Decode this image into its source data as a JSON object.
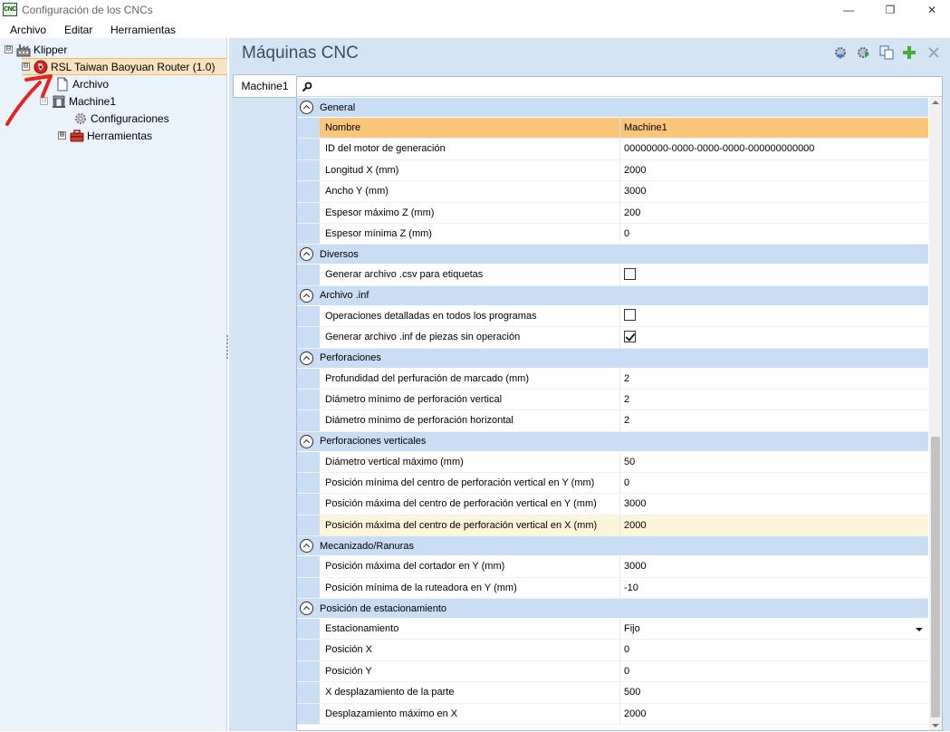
{
  "window": {
    "title": "Configuración de los CNCs",
    "icon_text": "CNC",
    "minimize": "—",
    "maximize": "❐",
    "close": "✕"
  },
  "menu": [
    "Archivo",
    "Editar",
    "Herramientas"
  ],
  "tree": [
    {
      "label": "Klipper",
      "expander": "⊟",
      "icon": "factory-icon"
    },
    {
      "label": "RSL Taiwan Baoyuan Router (1.0)",
      "expander": "⊟",
      "icon": "router-icon",
      "selected": true
    },
    {
      "label": "Archivo",
      "icon": "file-icon"
    },
    {
      "label": "Machine1",
      "expander": "⊟",
      "icon": "machine-icon"
    },
    {
      "label": "Configuraciones",
      "icon": "gear-icon"
    },
    {
      "label": "Herramientas",
      "expander": "⊞",
      "icon": "toolbox-icon"
    }
  ],
  "main": {
    "title": "Máquinas CNC",
    "toolbar_icons": [
      "gear-import-icon",
      "gear-export-icon",
      "copy-icon",
      "add-icon",
      "delete-icon"
    ],
    "tabs": [
      "Machine1"
    ],
    "search": {
      "value": "",
      "placeholder": ""
    }
  },
  "colors": {
    "selection": "#f9c67a",
    "tree_selection": "#fbe3c1",
    "category_bg": "#c9ddf5",
    "panel_bg": "#d5e4f5",
    "annotation": "#e8231e"
  },
  "grid": [
    {
      "category": "General",
      "rows": [
        {
          "name": "Nombre",
          "value": "Machine1",
          "selected": true
        },
        {
          "name": "ID del motor de generación",
          "value": "00000000-0000-0000-0000-000000000000"
        },
        {
          "name": "Longitud X (mm)",
          "value": "2000"
        },
        {
          "name": "Ancho Y (mm)",
          "value": "3000"
        },
        {
          "name": "Espesor máximo Z (mm)",
          "value": "200"
        },
        {
          "name": "Espesor mínima Z (mm)",
          "value": "0"
        }
      ]
    },
    {
      "category": "Diversos",
      "rows": [
        {
          "name": "Generar archivo .csv para etiquetas",
          "checkbox": false
        }
      ]
    },
    {
      "category": "Archivo .inf",
      "rows": [
        {
          "name": "Operaciones detalladas en todos los programas",
          "checkbox": false
        },
        {
          "name": "Generar archivo .inf de piezas sin operación",
          "checkbox": true
        }
      ]
    },
    {
      "category": "Perforaciones",
      "rows": [
        {
          "name": "Profundidad del perfuración de marcado (mm)",
          "value": "2"
        },
        {
          "name": "Diámetro mínimo de perforación vertical",
          "value": "2"
        },
        {
          "name": "Diámetro mínimo de perforación horizontal",
          "value": "2"
        }
      ]
    },
    {
      "category": "Perforaciones verticales",
      "rows": [
        {
          "name": "Diámetro vertical máximo (mm)",
          "value": "50"
        },
        {
          "name": "Posición mínima del centro de perforación vertical en Y (mm)",
          "value": "0"
        },
        {
          "name": "Posición máxima del centro de perforación vertical en Y (mm)",
          "value": "3000"
        },
        {
          "name": "Posición máxima del centro de perforación vertical en X (mm)",
          "value": "2000",
          "highlight": true
        }
      ]
    },
    {
      "category": "Mecanizado/Ranuras",
      "rows": [
        {
          "name": "Posición máxima del cortador en Y (mm)",
          "value": "3000"
        },
        {
          "name": "Posición mínima de la ruteadora en Y (mm)",
          "value": "-10"
        }
      ]
    },
    {
      "category": "Posición de estacionamiento",
      "rows": [
        {
          "name": "Estacionamiento",
          "value": "Fijo",
          "dropdown": true
        },
        {
          "name": "Posición X",
          "value": "0"
        },
        {
          "name": "Posición Y",
          "value": "0"
        },
        {
          "name": "X desplazamiento de la parte",
          "value": "500"
        },
        {
          "name": "Desplazamiento máximo en X",
          "value": "2000"
        }
      ]
    }
  ]
}
